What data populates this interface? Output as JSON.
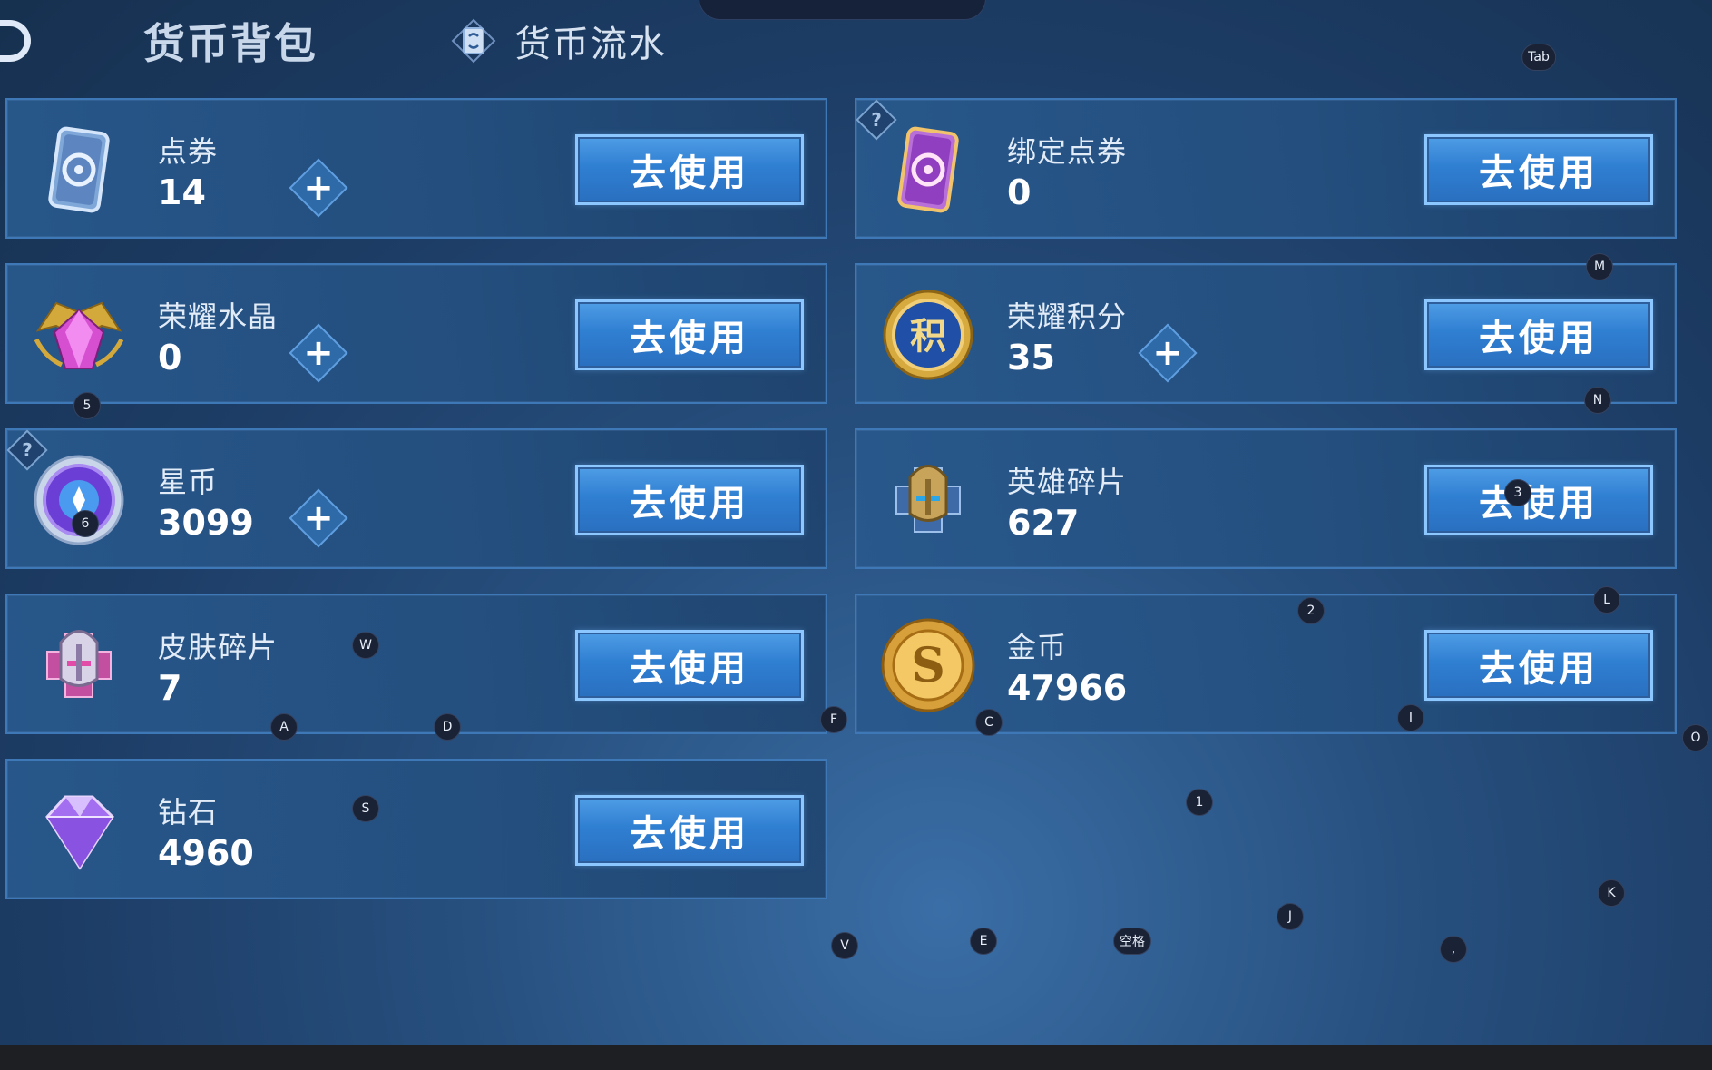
{
  "header": {
    "title": "货币背包",
    "flow_tab": "货币流水"
  },
  "cards": [
    {
      "name": "点券",
      "value": "14",
      "button": "去使用",
      "icon": "coupon-blue-icon"
    },
    {
      "name": "绑定点券",
      "value": "0",
      "button": "去使用",
      "icon": "coupon-purple-icon"
    },
    {
      "name": "荣耀水晶",
      "value": "0",
      "button": "去使用",
      "icon": "glory-crystal-icon"
    },
    {
      "name": "荣耀积分",
      "value": "35",
      "button": "去使用",
      "icon": "glory-points-icon"
    },
    {
      "name": "星币",
      "value": "3099",
      "button": "去使用",
      "icon": "star-coin-icon"
    },
    {
      "name": "英雄碎片",
      "value": "627",
      "button": "去使用",
      "icon": "hero-fragment-icon"
    },
    {
      "name": "皮肤碎片",
      "value": "7",
      "button": "去使用",
      "icon": "skin-fragment-icon"
    },
    {
      "name": "金币",
      "value": "47966",
      "button": "去使用",
      "icon": "gold-coin-icon"
    },
    {
      "name": "钻石",
      "value": "4960",
      "button": "去使用",
      "icon": "diamond-icon"
    }
  ],
  "help_label": "?",
  "plus_label": "+",
  "key_hints": [
    "Tab",
    "M",
    "5",
    "N",
    "6",
    "3",
    "2",
    "L",
    "W",
    "A",
    "D",
    "F",
    "C",
    "I",
    "O",
    "S",
    "1",
    "K",
    "J",
    "V",
    "E",
    "空格",
    ","
  ]
}
